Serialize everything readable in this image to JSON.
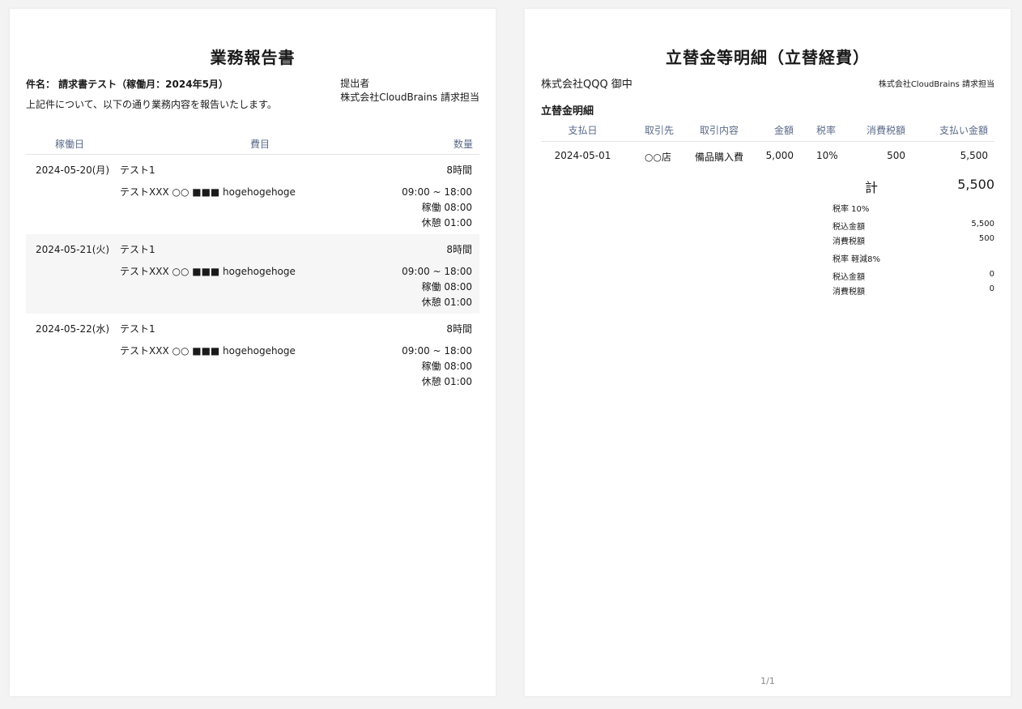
{
  "report": {
    "title": "業務報告書",
    "subject": "件名： 請求書テスト（稼働月：2024年5月）",
    "intro": "上記件について、以下の通り業務内容を報告いたします。",
    "submitter_label": "提出者",
    "submitter_name": "株式会社CloudBrains 請求担当",
    "columns": {
      "date": "稼働日",
      "item": "費目",
      "qty": "数量"
    },
    "rows": [
      {
        "date": "2024-05-20(月)",
        "item": "テスト1",
        "hours": "8時間",
        "desc": "テストXXX ○○ ■■■ hogehogehoge",
        "time_range": "09:00 ~ 18:00",
        "work": "稼働 08:00",
        "break": "休憩 01:00"
      },
      {
        "date": "2024-05-21(火)",
        "item": "テスト1",
        "hours": "8時間",
        "desc": "テストXXX ○○ ■■■ hogehogehoge",
        "time_range": "09:00 ~ 18:00",
        "work": "稼働 08:00",
        "break": "休憩 01:00"
      },
      {
        "date": "2024-05-22(水)",
        "item": "テスト1",
        "hours": "8時間",
        "desc": "テストXXX ○○ ■■■ hogehogehoge",
        "time_range": "09:00 ~ 18:00",
        "work": "稼働 08:00",
        "break": "休憩 01:00"
      }
    ]
  },
  "expense": {
    "title": "立替金等明細（立替経費）",
    "client": "株式会社QQQ 御中",
    "issuer": "株式会社CloudBrains 請求担当",
    "section_title": "立替金明細",
    "columns": {
      "date": "支払日",
      "vendor": "取引先",
      "content": "取引内容",
      "amount": "金額",
      "rate": "税率",
      "tax": "消費税額",
      "payment": "支払い金額"
    },
    "rows": [
      {
        "date": "2024-05-01",
        "vendor": "○○店",
        "content": "備品購入費",
        "amount": "5,000",
        "rate": "10%",
        "tax": "500",
        "payment": "5,500"
      }
    ],
    "total_label": "計",
    "total_value": "5,500",
    "summary": {
      "rate10_label": "税率 10%",
      "rate10_incl_label": "税込金額",
      "rate10_incl_value": "5,500",
      "rate10_tax_label": "消費税額",
      "rate10_tax_value": "500",
      "rate8_label": "税率 軽減8%",
      "rate8_incl_label": "税込金額",
      "rate8_incl_value": "0",
      "rate8_tax_label": "消費税額",
      "rate8_tax_value": "0"
    },
    "page_number": "1/1"
  }
}
